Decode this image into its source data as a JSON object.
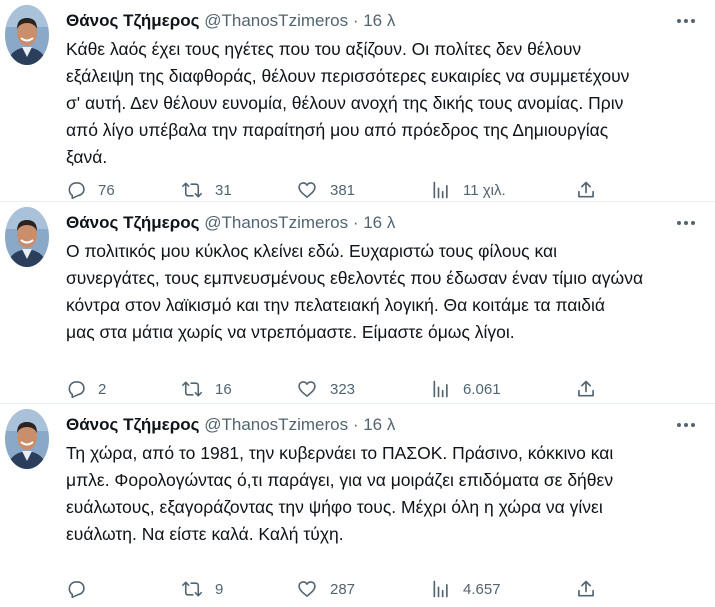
{
  "tweets": [
    {
      "author": "Θάνος Τζήμερος",
      "handle": "@ThanosTzimeros",
      "separator": "·",
      "time": "16 λ",
      "text": "Κάθε λαός έχει τους ηγέτες που του αξίζουν. Οι πολίτες δεν θέλουν\nεξάλειψη της διαφθοράς, θέλουν περισσότερες ευκαιρίες να συμμετέχουν\nσ' αυτή. Δεν θέλουν ευνομία, θέλουν ανοχή της δικής τους ανομίας. Πριν\nαπό λίγο υπέβαλα την παραίτησή μου από πρόεδρος της Δημιουργίας\nξανά.",
      "replies": "76",
      "retweets": "31",
      "likes": "381",
      "views": "11 χιλ."
    },
    {
      "author": "Θάνος Τζήμερος",
      "handle": "@ThanosTzimeros",
      "separator": "·",
      "time": "16 λ",
      "text": "Ο πολιτικός μου κύκλος κλείνει εδώ. Ευχαριστώ τους φίλους και\nσυνεργάτες, τους εμπνευσμένους εθελοντές που έδωσαν έναν τίμιο αγώνα\nκόντρα στον λαϊκισμό και την πελατειακή λογική. Θα κοιτάμε τα παιδιά\nμας στα μάτια χωρίς να ντρεπόμαστε. Είμαστε όμως λίγοι.",
      "replies": "2",
      "retweets": "16",
      "likes": "323",
      "views": "6.061"
    },
    {
      "author": "Θάνος Τζήμερος",
      "handle": "@ThanosTzimeros",
      "separator": "·",
      "time": "16 λ",
      "text": "Τη χώρα, από το 1981, την κυβερνάει το ΠΑΣΟΚ. Πράσινο, κόκκινο και\nμπλε. Φορολογώντας ό,τι παράγει, για να μοιράζει επιδόματα σε δήθεν\nευάλωτους, εξαγοράζοντας την ψήφο τους. Μέχρι όλη η χώρα να γίνει\nευάλωτη. Να είστε καλά. Καλή τύχη.",
      "replies": "",
      "retweets": "9",
      "likes": "287",
      "views": "4.657"
    }
  ],
  "icons": {
    "avatar": "avatar-photo",
    "more": "more-dots-icon",
    "reply": "reply-icon",
    "retweet": "retweet-icon",
    "like": "heart-icon",
    "views": "views-icon",
    "share": "share-icon"
  },
  "colors": {
    "text": "#0f1419",
    "secondary": "#536471",
    "divider": "#e8ecee"
  }
}
